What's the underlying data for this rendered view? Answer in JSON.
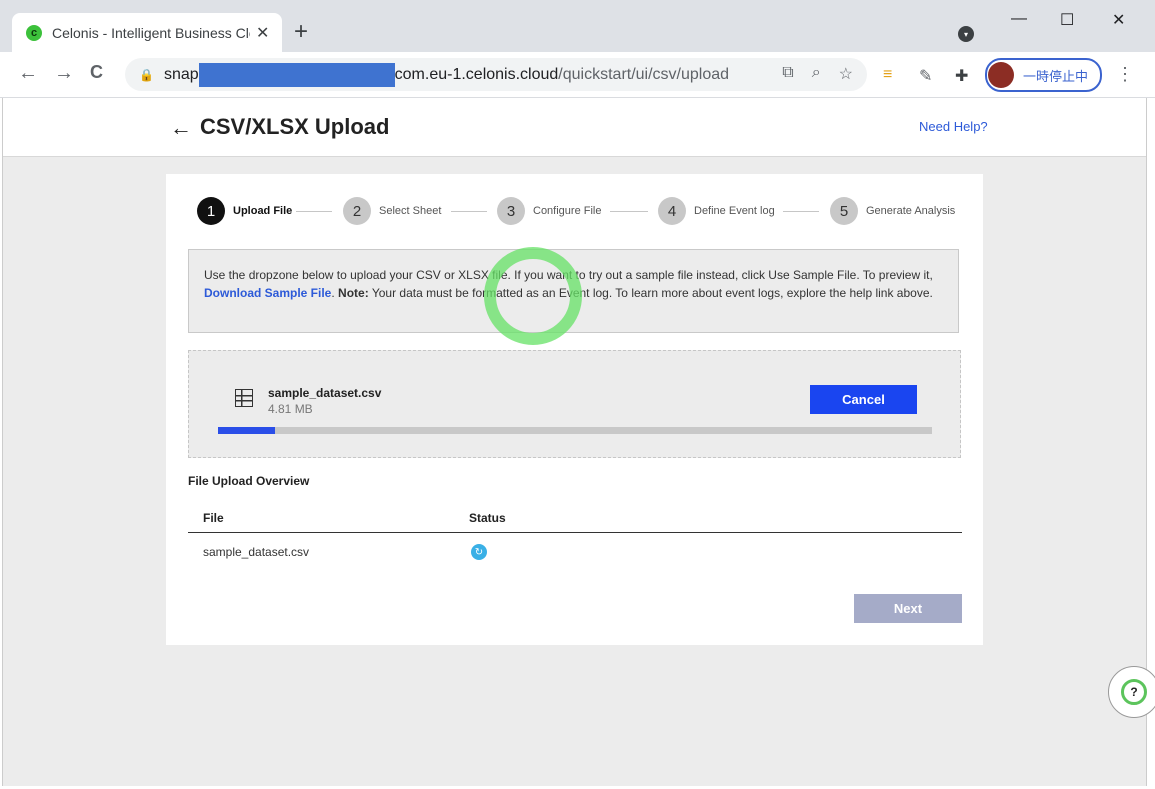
{
  "browser": {
    "tab_title": "Celonis - Intelligent Business Cloud",
    "tab_favicon_letter": "c",
    "url_prefix": "snap",
    "url_host": "com.eu-1.celonis.cloud",
    "url_path": "/quickstart/ui/csv/upload",
    "profile_label": "一時停止中"
  },
  "header": {
    "title": "CSV/XLSX Upload",
    "help_link": "Need Help?"
  },
  "steps": [
    {
      "num": "1",
      "label": "Upload File",
      "active": true
    },
    {
      "num": "2",
      "label": "Select Sheet",
      "active": false
    },
    {
      "num": "3",
      "label": "Configure File",
      "active": false
    },
    {
      "num": "4",
      "label": "Define Event log",
      "active": false
    },
    {
      "num": "5",
      "label": "Generate Analysis",
      "active": false
    }
  ],
  "info": {
    "text1": "Use the dropzone below to upload your CSV or XLSX file. If you want to try out a sample file instead, click Use Sample File. To preview it, ",
    "link": "Download Sample File",
    "text2": ". ",
    "note_label": "Note:",
    "text3": " Your data must be formatted as an Event log. To learn more about event logs, explore the help link above."
  },
  "upload": {
    "file_name": "sample_dataset.csv",
    "file_size": "4.81 MB",
    "cancel_label": "Cancel",
    "progress_fraction": 0.08
  },
  "overview": {
    "title": "File Upload Overview",
    "columns": [
      "File",
      "Status"
    ],
    "rows": [
      {
        "file": "sample_dataset.csv",
        "status_icon": "loading-icon"
      }
    ]
  },
  "next_label": "Next",
  "icons": {
    "back": "←",
    "forward": "→",
    "reload": "C",
    "lock": "🔒",
    "close": "✕",
    "plus": "+",
    "translate": "⧉",
    "zoom": "⌕",
    "star": "☆",
    "puzzle": "✚",
    "kebab": "⋮",
    "arrow_left": "←",
    "help": "?",
    "status": "↻",
    "minimize": "—",
    "maximize": "☐",
    "win_close": "✕",
    "ext_surf": "≡",
    "ext_note": "✎",
    "chevron": "▾"
  }
}
